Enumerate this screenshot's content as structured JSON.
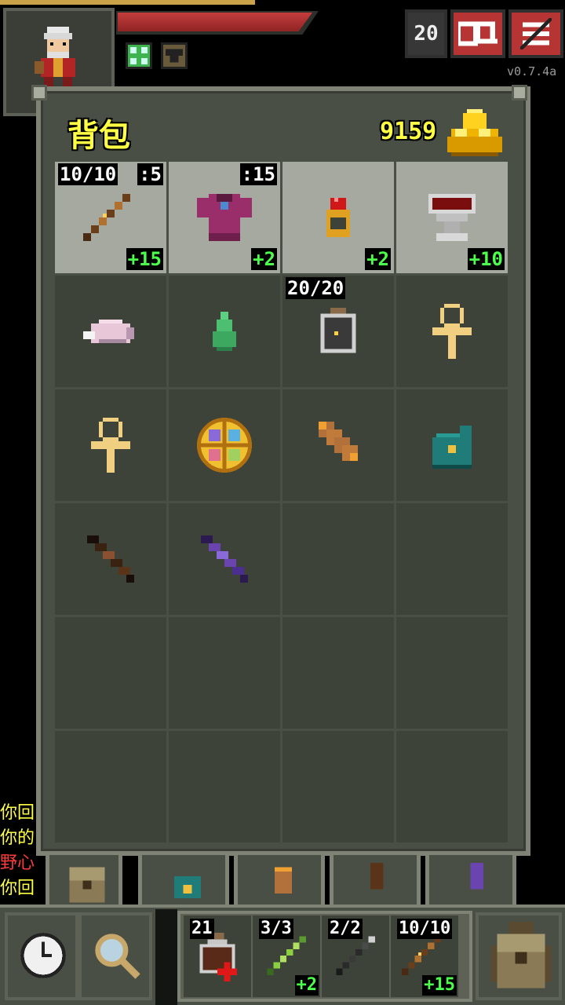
{
  "hud": {
    "depth": "20",
    "version": "v0.7.4a",
    "buffs": [
      "healing-buff-icon",
      "armor-buff-icon"
    ]
  },
  "log": [
    {
      "text": "你回",
      "color": "#ffff44"
    },
    {
      "text": "你的",
      "color": "#ffff44"
    },
    {
      "text": "野心",
      "color": "#ff3b3b"
    },
    {
      "text": "你回",
      "color": "#ffff44"
    }
  ],
  "backpack": {
    "title": "背包",
    "gold": "9159",
    "slots": [
      {
        "name": "wand-slot",
        "icon": "wand-icon",
        "equipped": true,
        "top_left": "10/10",
        "top_right": ":5",
        "bottom_right": "+15"
      },
      {
        "name": "armor-slot",
        "icon": "robe-armor-icon",
        "equipped": true,
        "top_left": "",
        "top_right": ":15",
        "bottom_right": "+2"
      },
      {
        "name": "ring-slot",
        "icon": "ring-icon",
        "equipped": true,
        "top_left": "",
        "top_right": "",
        "bottom_right": "+2"
      },
      {
        "name": "artifact-slot",
        "icon": "chalice-icon",
        "equipped": true,
        "top_left": "",
        "top_right": "",
        "bottom_right": "+10"
      },
      {
        "name": "item-slot",
        "icon": "pink-stone-icon",
        "equipped": false,
        "top_left": "",
        "top_right": "",
        "bottom_right": ""
      },
      {
        "name": "item-slot",
        "icon": "green-seed-icon",
        "equipped": false,
        "top_left": "",
        "top_right": "",
        "bottom_right": ""
      },
      {
        "name": "item-slot",
        "icon": "dew-vial-icon",
        "equipped": false,
        "top_left": "20/20",
        "top_right": "",
        "bottom_right": ""
      },
      {
        "name": "item-slot",
        "icon": "ankh-icon",
        "equipped": false,
        "top_left": "",
        "top_right": "",
        "bottom_right": ""
      },
      {
        "name": "item-slot",
        "icon": "ankh-icon",
        "equipped": false,
        "top_left": "",
        "top_right": "",
        "bottom_right": ""
      },
      {
        "name": "item-slot",
        "icon": "scroll-holder-icon",
        "equipped": false,
        "top_left": "",
        "top_right": "",
        "bottom_right": ""
      },
      {
        "name": "item-slot",
        "icon": "wand-holster-icon",
        "equipped": false,
        "top_left": "",
        "top_right": "",
        "bottom_right": ""
      },
      {
        "name": "item-slot",
        "icon": "seed-pouch-icon",
        "equipped": false,
        "top_left": "",
        "top_right": "",
        "bottom_right": ""
      },
      {
        "name": "item-slot",
        "icon": "dark-wand-icon",
        "equipped": false,
        "top_left": "",
        "top_right": "",
        "bottom_right": ""
      },
      {
        "name": "item-slot",
        "icon": "purple-wand-icon",
        "equipped": false,
        "top_left": "",
        "top_right": "",
        "bottom_right": ""
      },
      {
        "name": "empty-slot",
        "icon": "",
        "equipped": false,
        "top_left": "",
        "top_right": "",
        "bottom_right": ""
      },
      {
        "name": "empty-slot",
        "icon": "",
        "equipped": false,
        "top_left": "",
        "top_right": "",
        "bottom_right": ""
      },
      {
        "name": "empty-slot",
        "icon": "",
        "equipped": false,
        "top_left": "",
        "top_right": "",
        "bottom_right": ""
      },
      {
        "name": "empty-slot",
        "icon": "",
        "equipped": false,
        "top_left": "",
        "top_right": "",
        "bottom_right": ""
      },
      {
        "name": "empty-slot",
        "icon": "",
        "equipped": false,
        "top_left": "",
        "top_right": "",
        "bottom_right": ""
      },
      {
        "name": "empty-slot",
        "icon": "",
        "equipped": false,
        "top_left": "",
        "top_right": "",
        "bottom_right": ""
      },
      {
        "name": "empty-slot",
        "icon": "",
        "equipped": false,
        "top_left": "",
        "top_right": "",
        "bottom_right": ""
      },
      {
        "name": "empty-slot",
        "icon": "",
        "equipped": false,
        "top_left": "",
        "top_right": "",
        "bottom_right": ""
      },
      {
        "name": "empty-slot",
        "icon": "",
        "equipped": false,
        "top_left": "",
        "top_right": "",
        "bottom_right": ""
      },
      {
        "name": "empty-slot",
        "icon": "",
        "equipped": false,
        "top_left": "",
        "top_right": "",
        "bottom_right": ""
      }
    ],
    "tabs": [
      "backpack-tab-icon",
      "seed-pouch-tab-icon",
      "scroll-holder-tab-icon",
      "wand-holster-tab-icon",
      "purple-wand-tab-icon"
    ]
  },
  "toolbar": {
    "quickslots": [
      {
        "icon": "healing-potion-icon",
        "top_left": "21",
        "bottom_right": ""
      },
      {
        "icon": "green-wand-icon",
        "top_left": "3/3",
        "bottom_right": "+2"
      },
      {
        "icon": "dark-staff-icon",
        "top_left": "2/2",
        "bottom_right": ""
      },
      {
        "icon": "wand-icon",
        "top_left": "10/10",
        "bottom_right": "+15"
      }
    ]
  },
  "colors": {
    "panel": "#4a4f45",
    "slot": "#3e433a",
    "equipped_slot": "#a6a99f",
    "gold_text": "#ffff44",
    "upgrade_text": "#4cff4c",
    "danger_button": "#b63434"
  }
}
